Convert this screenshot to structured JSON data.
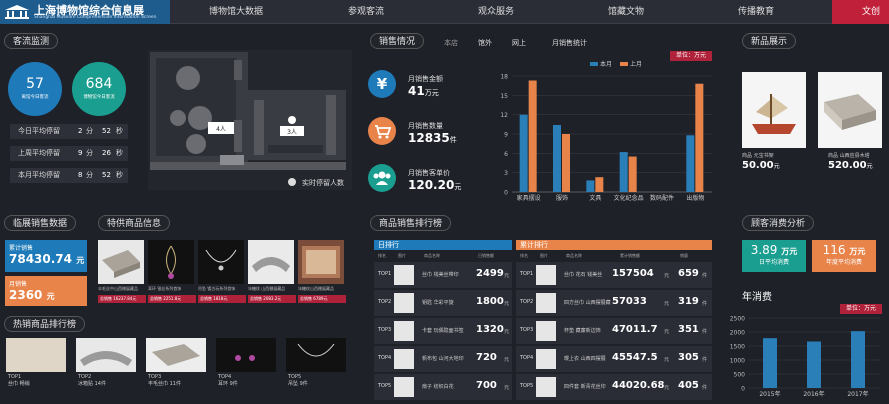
{
  "header": {
    "title": "上海博物馆综合信息展",
    "subtitle": "Shanghai Museum Comprehensive Information Screen",
    "nav": [
      "博物馆大数据",
      "参观客流",
      "观众服务",
      "馆藏文物",
      "传播教育",
      "文创"
    ]
  },
  "visitor": {
    "title": "客流监测",
    "today_visitors": "57",
    "today_visitors_label": "离馆今日客流",
    "in_museum": "684",
    "in_museum_label": "博物馆今日客流",
    "rows": [
      {
        "label": "今日平均停留",
        "h": "2",
        "hu": "分",
        "m": "52",
        "mu": "秒"
      },
      {
        "label": "上周平均停留",
        "h": "9",
        "hu": "分",
        "m": "26",
        "mu": "秒"
      },
      {
        "label": "本月平均停留",
        "h": "8",
        "hu": "分",
        "m": "52",
        "mu": "秒"
      }
    ],
    "map_labels": [
      "4人",
      "3人"
    ],
    "realtime_label": "实时停留人数"
  },
  "sales": {
    "title": "销售情况",
    "tabs": [
      "本店",
      "馆外",
      "网上",
      "月销售统计"
    ],
    "items": [
      {
        "label": "月销售金额",
        "value": "41",
        "unit": "万元"
      },
      {
        "label": "月销售数量",
        "value": "12835",
        "unit": "件"
      },
      {
        "label": "月销售客单价",
        "value": "120.20",
        "unit": "元"
      }
    ],
    "unit_badge": "单位：万元"
  },
  "chart_data": {
    "type": "bar",
    "categories": [
      "家具摆设",
      "服饰",
      "文具",
      "文化纪念品",
      "数码配件",
      "出版物"
    ],
    "series": [
      {
        "name": "本月",
        "values": [
          12,
          10.4,
          1.8,
          6.2,
          0,
          8.8
        ],
        "color": "#2a7fb8"
      },
      {
        "name": "上月",
        "values": [
          17.3,
          9,
          2.3,
          5.5,
          0,
          16.8
        ],
        "color": "#e8844a"
      }
    ],
    "ylim": [
      0,
      18
    ],
    "yticks": [
      0,
      3,
      6,
      9,
      12,
      15,
      18
    ]
  },
  "new_products": {
    "title": "新品展示",
    "items": [
      {
        "label": "商品 元宝书架",
        "price": "50.00",
        "unit": "元"
      },
      {
        "label": "商品 山西应县木塔",
        "price": "520.00",
        "unit": "元"
      }
    ]
  },
  "retail": {
    "title": "临展销售数据",
    "total_label": "累计销售",
    "total_value": "78430.74",
    "total_unit": "元",
    "month_label": "月销售",
    "month_value": "2360",
    "month_unit": "元"
  },
  "special": {
    "title": "特供商品信息",
    "items": [
      {
        "name": "丰毛丝中山西棚展藏品",
        "sales": "总销售 16237.84元"
      },
      {
        "name": "耳环 银丝系列首饰",
        "sales": "总销售 2251.8元"
      },
      {
        "name": "吊坠 镀古玩系列首饰",
        "sales": "总销售 1818元"
      },
      {
        "name": "冰糖纹 山西棚展藏品",
        "sales": "总销售 2083.2元"
      },
      {
        "name": "冰糖纹山西棚展藏品",
        "sales": "总销售 6789元"
      }
    ]
  },
  "hot": {
    "title": "热销商品排行榜",
    "items": [
      {
        "rank": "TOP1",
        "name": "丝巾",
        "sub": "畅销"
      },
      {
        "rank": "TOP2",
        "name": "冰箱贴",
        "sub": "14件"
      },
      {
        "rank": "TOP3",
        "name": "丰毛丝巾",
        "sub": "11件"
      },
      {
        "rank": "TOP4",
        "name": "耳环",
        "sub": "9件"
      },
      {
        "rank": "TOP5",
        "name": "吊坠",
        "sub": "9件"
      }
    ]
  },
  "rank": {
    "title": "商品销售排行榜",
    "day_title": "日排行",
    "total_title": "累计排行",
    "cols": [
      "排名",
      "图片",
      "商品名称",
      "日销售额",
      "销量"
    ],
    "cols_total": [
      "排名",
      "图片",
      "商品名称",
      "累计销售额",
      "销量"
    ],
    "day": [
      {
        "no": "TOP1",
        "name": "丝巾 钱美丝带印",
        "value": "2499",
        "unit": "元"
      },
      {
        "no": "TOP2",
        "name": "钥匙 华彩平旋",
        "value": "1800",
        "unit": "元"
      },
      {
        "no": "TOP3",
        "name": "卡套 玩偶隐面书签",
        "value": "1320",
        "unit": "元"
      },
      {
        "no": "TOP4",
        "name": "帆布包 山河大地印",
        "value": "720",
        "unit": "元"
      },
      {
        "no": "TOP5",
        "name": "扇子 纺织白花",
        "value": "700",
        "unit": "元"
      }
    ],
    "total": [
      {
        "no": "TOP1",
        "name": "丝巾 花石 钱美丝",
        "value": "157504",
        "unit": "元",
        "qty": "659",
        "qunit": "件"
      },
      {
        "no": "TOP2",
        "name": "四方丝巾 山西摆展藏",
        "value": "57033",
        "unit": "元",
        "qty": "319",
        "qunit": "件"
      },
      {
        "no": "TOP3",
        "name": "杯垫 藏廉新边饰",
        "value": "47011.7",
        "unit": "元",
        "qty": "351",
        "qunit": "件"
      },
      {
        "no": "TOP4",
        "name": "璎上衣 山西四摆展",
        "value": "45547.5",
        "unit": "元",
        "qty": "305",
        "qunit": "件"
      },
      {
        "no": "TOP5",
        "name": "四件套 新青花丝印",
        "value": "44020.68",
        "unit": "元",
        "qty": "405",
        "qunit": "件"
      }
    ]
  },
  "consumer": {
    "title": "顾客消费分析",
    "daily_value": "3.89",
    "daily_unit": "万元",
    "daily_label": "日平均消费",
    "visitor_value": "116",
    "visitor_unit": "万元",
    "visitor_label": "年度平均消费",
    "annual_title": "年消费",
    "unit_badge": "单位：万元"
  },
  "annual_chart": {
    "type": "bar",
    "categories": [
      "2015年",
      "2016年",
      "2017年"
    ],
    "values": [
      1780,
      1660,
      2030
    ],
    "ylim": [
      0,
      2500
    ],
    "yticks": [
      0,
      500,
      1000,
      1500,
      2000,
      2500
    ],
    "color": "#2a7fb8"
  }
}
